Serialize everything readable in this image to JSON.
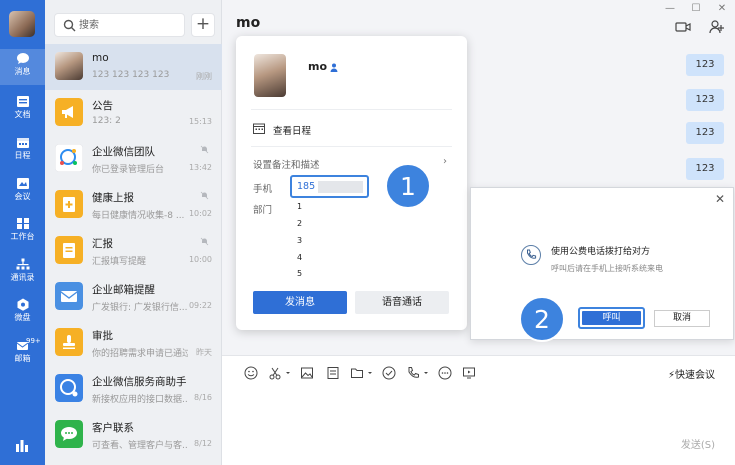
{
  "rail": {
    "items": [
      {
        "label": "消息",
        "icon": "chat-bubble-icon"
      },
      {
        "label": "文档",
        "icon": "document-icon"
      },
      {
        "label": "日程",
        "icon": "calendar-icon"
      },
      {
        "label": "会议",
        "icon": "meeting-icon"
      },
      {
        "label": "工作台",
        "icon": "workbench-icon"
      },
      {
        "label": "通讯录",
        "icon": "contacts-icon"
      },
      {
        "label": "微盘",
        "icon": "drive-icon"
      },
      {
        "label": "邮箱",
        "icon": "mail-icon"
      }
    ],
    "mail_badge": "99+"
  },
  "search": {
    "placeholder": "搜索",
    "add_label": "+"
  },
  "conversations": [
    {
      "name": "mo",
      "preview": "123 123 123 123",
      "time": "刚刚"
    },
    {
      "name": "公告",
      "preview": "123: 2",
      "time": "15:13"
    },
    {
      "name": "企业微信团队",
      "preview": "你已登录管理后台",
      "time": "13:42"
    },
    {
      "name": "健康上报",
      "preview": "每日健康情况收集-8 ...",
      "time": "10:02"
    },
    {
      "name": "汇报",
      "preview": "汇报填写提醒",
      "time": "10:00"
    },
    {
      "name": "企业邮箱提醒",
      "preview": "广发银行: 广发银行信...",
      "time": "09:22"
    },
    {
      "name": "审批",
      "preview": "你的招聘需求申请已通过",
      "time": "昨天"
    },
    {
      "name": "企业微信服务商助手",
      "preview": "新接权应用的接口数据...",
      "time": "8/16"
    },
    {
      "name": "客户联系",
      "preview": "可查看、管理客户与客...",
      "time": "8/12"
    }
  ],
  "chat": {
    "title": "mo",
    "bubbles": [
      "123",
      "123",
      "123",
      "123"
    ],
    "quick_meeting": "快速会议",
    "send": "发送(S)"
  },
  "profile": {
    "name": "mo",
    "view_schedule": "查看日程",
    "set_remark": "设置备注和描述",
    "phone_label": "手机",
    "phone_value": "185",
    "dept_label": "部门",
    "departments": [
      "1",
      "2",
      "3",
      "4",
      "5"
    ],
    "send_message": "发消息",
    "voice_call": "语音通话"
  },
  "steps": [
    "1",
    "2"
  ],
  "dialog": {
    "title": "使用公费电话拨打给对方",
    "subtitle": "呼叫后请在手机上接听系统来电",
    "ok": "呼叫",
    "cancel": "取消"
  },
  "colors": {
    "accent": "#2f6fd6",
    "highlight": "#3d83de",
    "bubble": "#cfe3fb"
  }
}
